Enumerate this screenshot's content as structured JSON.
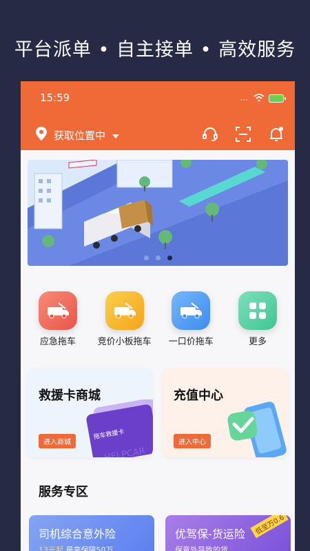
{
  "tagline": "平台派单 • 自主接单 • 高效服务",
  "status": {
    "time": "15:59"
  },
  "header": {
    "location": "获取位置中"
  },
  "services": [
    {
      "label": "应急拖车",
      "color": "#f06a5e"
    },
    {
      "label": "竞价小板拖车",
      "color": "#f7b228"
    },
    {
      "label": "一口价拖车",
      "color": "#4e9cf2"
    },
    {
      "label": "更多",
      "color": "#54d3a3"
    }
  ],
  "cards": {
    "left": {
      "title": "救援卡商城",
      "button": "进入商城",
      "card_text": "拖车救援卡",
      "watermark": "HELPCAR"
    },
    "right": {
      "title": "充值中心",
      "button": "进入中心"
    }
  },
  "section": {
    "title": "服务专区"
  },
  "promos": [
    {
      "title": "司机综合意外险",
      "sub_highlight": "13元起",
      "sub": "最高保障50万"
    },
    {
      "title": "优驾保-货运险",
      "sub": "保意外导致的货",
      "badge": "低至万0.6"
    }
  ],
  "accent": "#ef6a36"
}
